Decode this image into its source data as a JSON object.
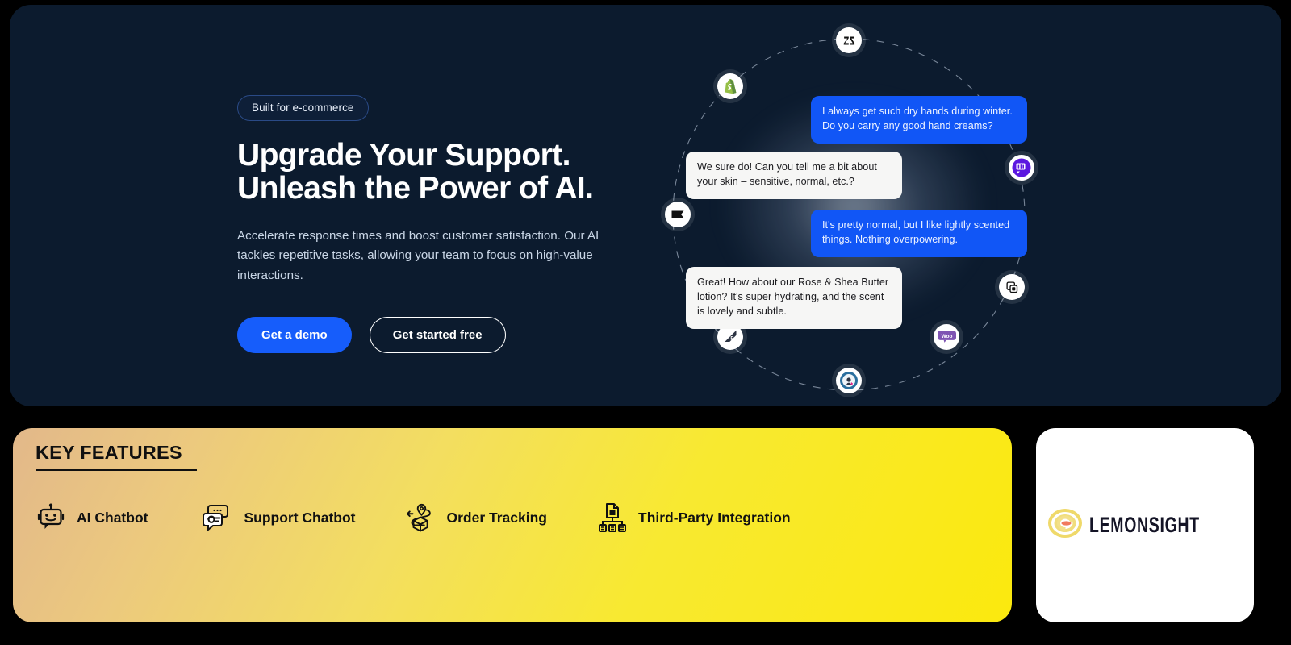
{
  "hero": {
    "badge": "Built for e-commerce",
    "headline_line1": "Upgrade Your Support.",
    "headline_line2": "Unleash the Power of AI.",
    "subcopy": "Accelerate response times and boost customer satisfaction. Our AI tackles repetitive tasks, allowing your team to focus on high-value interactions.",
    "cta_primary": "Get a demo",
    "cta_secondary": "Get started free",
    "accent_blue": "#165dfb",
    "card_bg": "#0c1b2e"
  },
  "chat": {
    "messages": [
      {
        "role": "user",
        "text": "I always get such dry hands during winter. Do you carry any good hand creams?"
      },
      {
        "role": "bot",
        "text": "We sure do! Can you tell me a bit about your skin – sensitive, normal, etc.?"
      },
      {
        "role": "user",
        "text": "It's pretty normal, but I like lightly scented things. Nothing overpowering."
      },
      {
        "role": "bot",
        "text": "Great! How about our Rose & Shea Butter lotion? It's super hydrating, and the scent is lovely and subtle."
      }
    ],
    "bubble_user_color": "#1156f6",
    "bubble_bot_color": "#f6f6f5"
  },
  "orbit": {
    "nodes": [
      {
        "name": "zendesk",
        "label": "Zendesk"
      },
      {
        "name": "shopify",
        "label": "Shopify"
      },
      {
        "name": "intercom",
        "label": "Intercom"
      },
      {
        "name": "bigcartel",
        "label": "Big Cartel"
      },
      {
        "name": "ecwid",
        "label": "Ecwid"
      },
      {
        "name": "bigcommerce",
        "label": "BigCommerce"
      },
      {
        "name": "magento",
        "label": "Magento"
      },
      {
        "name": "woocommerce",
        "label": "WooCommerce"
      }
    ]
  },
  "features": {
    "title": "KEY FEATURES",
    "items": [
      {
        "label": "AI Chatbot",
        "icon": "robot-icon"
      },
      {
        "label": "Support Chatbot",
        "icon": "chat-headset-icon"
      },
      {
        "label": "Order Tracking",
        "icon": "package-route-icon"
      },
      {
        "label": "Third-Party Integration",
        "icon": "integration-hierarchy-icon"
      }
    ],
    "gradient_from": "#e2b88a",
    "gradient_to": "#fbe90e"
  },
  "brand": {
    "name": "LEMONSIGHT",
    "mark": "lemon-swirl-icon",
    "mark_color": "#efd96a",
    "mark_accent": "#f1795c"
  }
}
